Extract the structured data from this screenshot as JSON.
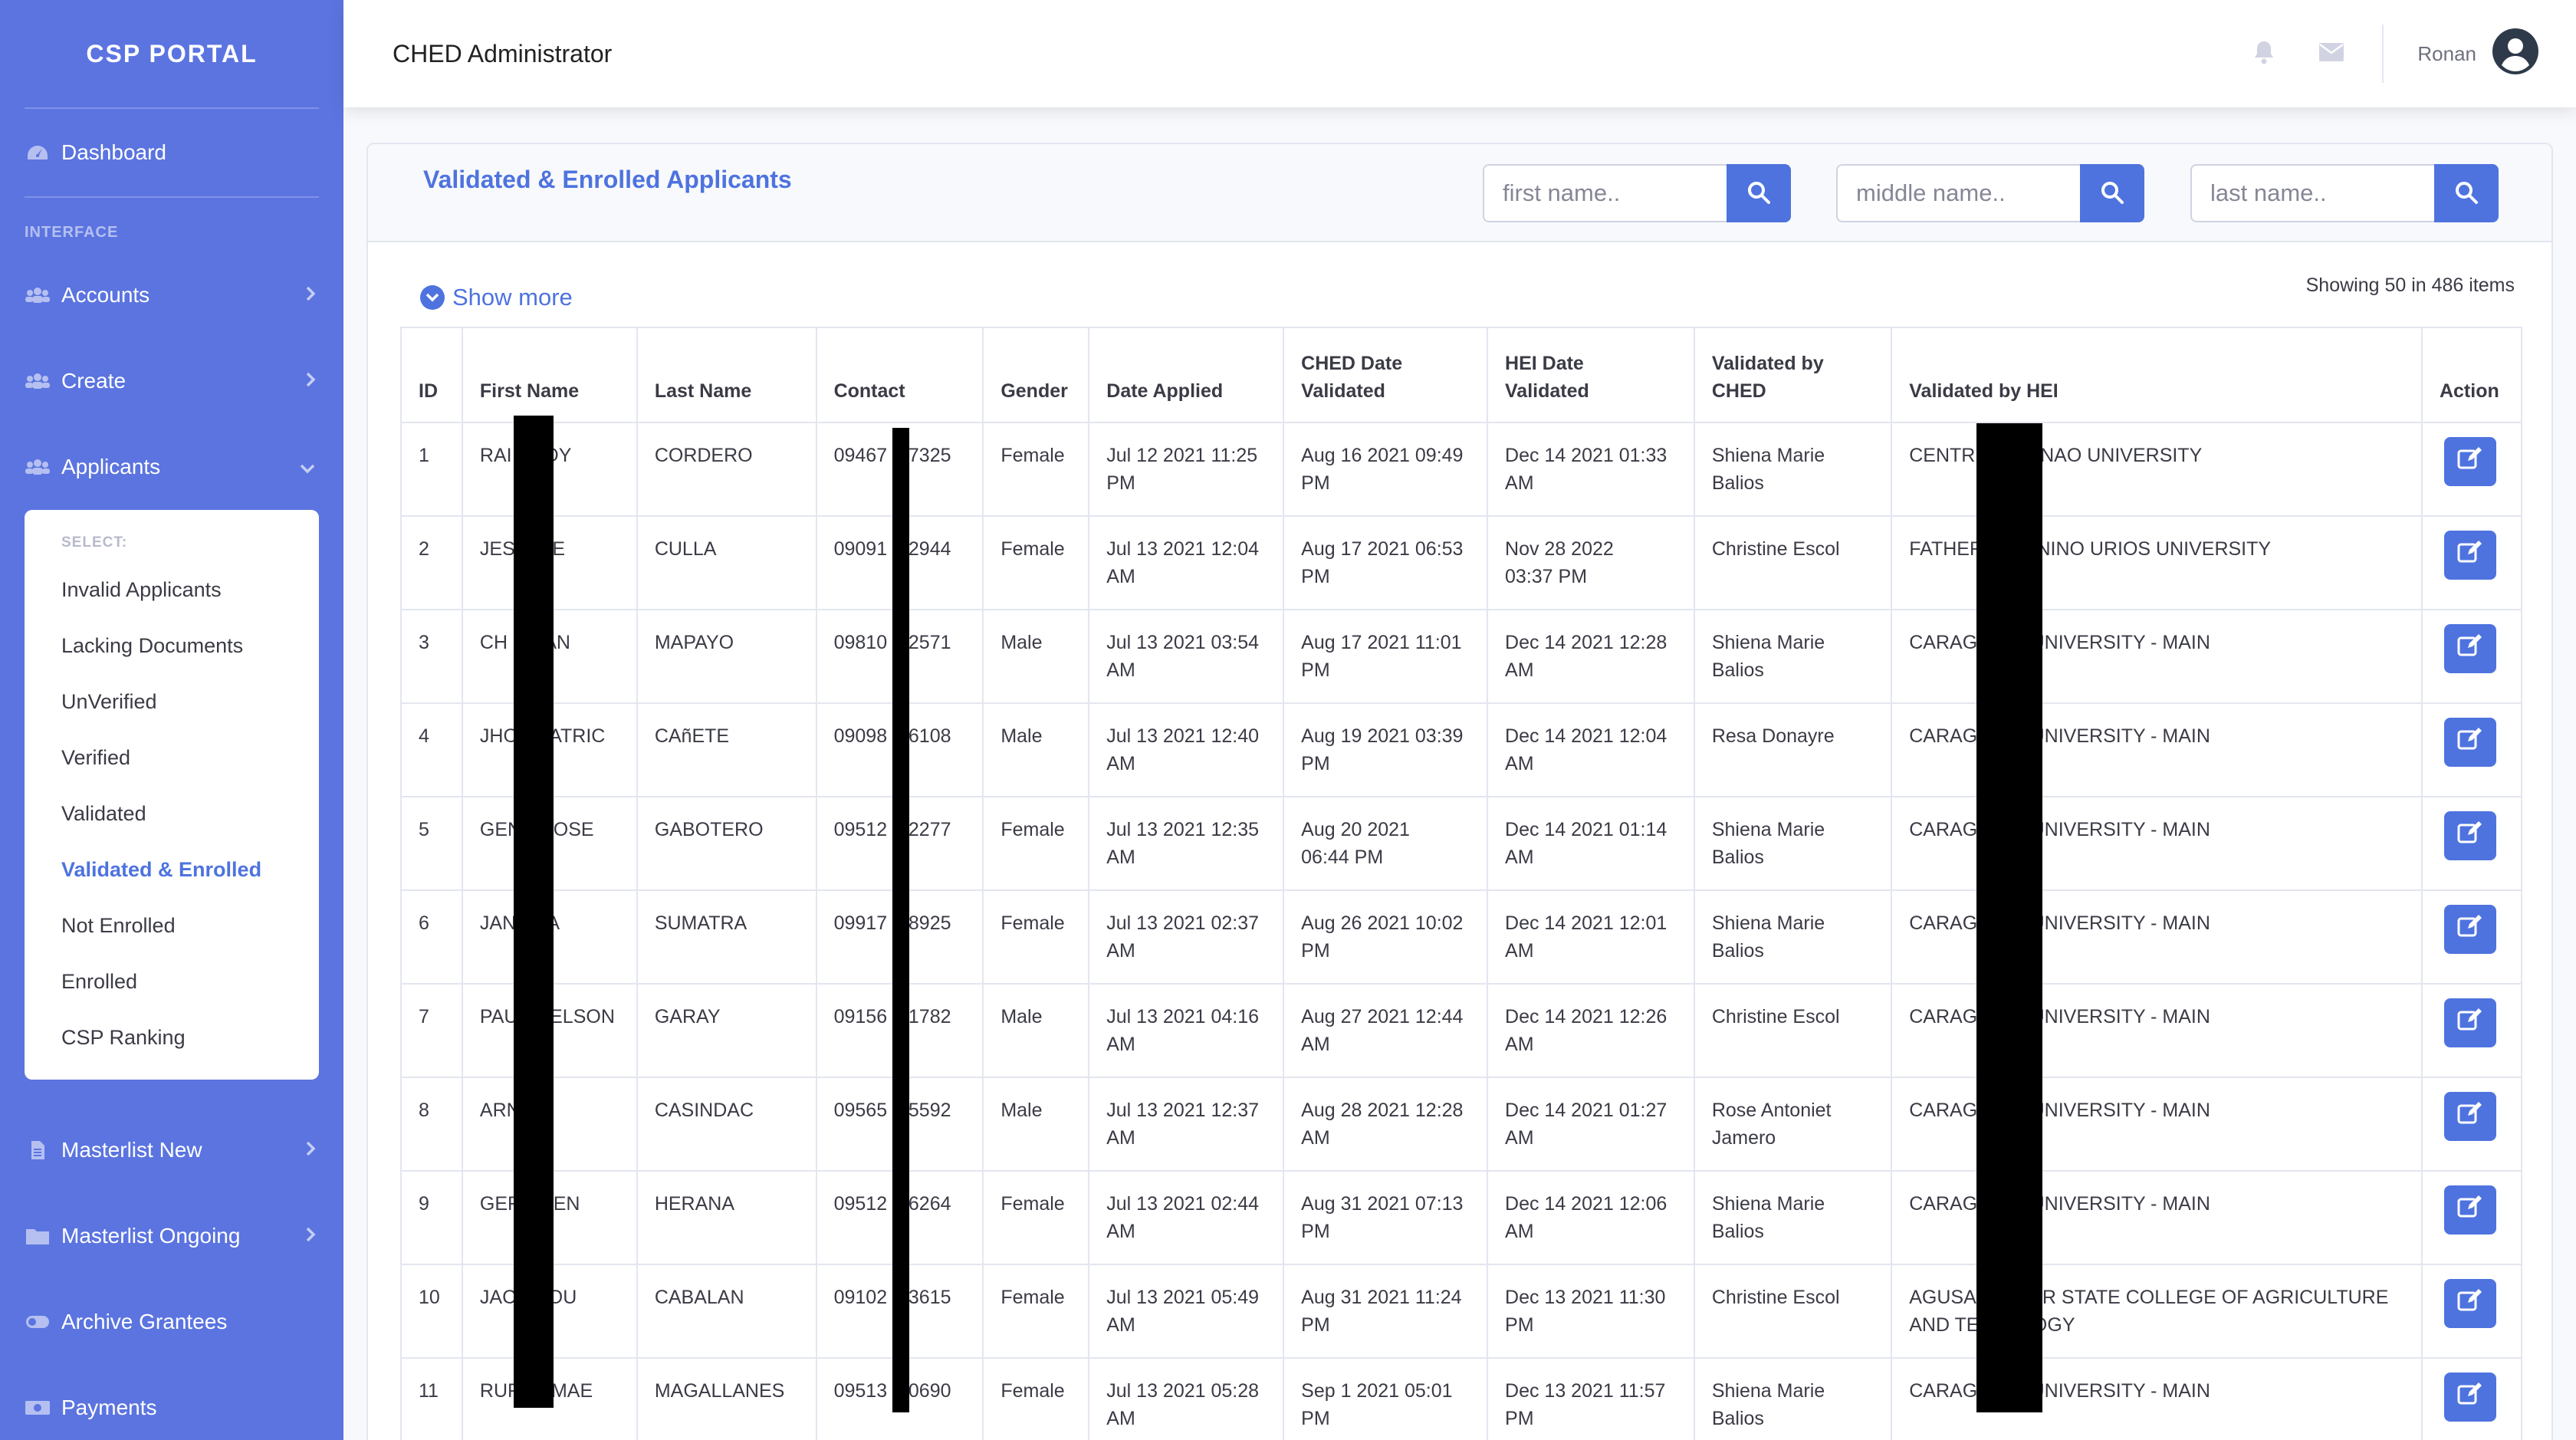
{
  "sidebar": {
    "brand": "CSP PORTAL",
    "dashboard": "Dashboard",
    "interface_heading": "INTERFACE",
    "accounts": "Accounts",
    "create": "Create",
    "applicants": "Applicants",
    "submenu_heading": "SELECT:",
    "submenu": [
      "Invalid Applicants",
      "Lacking Documents",
      "UnVerified",
      "Verified",
      "Validated",
      "Validated & Enrolled",
      "Not Enrolled",
      "Enrolled",
      "CSP Ranking"
    ],
    "submenu_active": "Validated & Enrolled",
    "masterlist_new": "Masterlist New",
    "masterlist_ongoing": "Masterlist Ongoing",
    "archive_grantees": "Archive Grantees",
    "payments": "Payments"
  },
  "topbar": {
    "title": "CHED Administrator",
    "user_name": "Ronan"
  },
  "card": {
    "title": "Validated & Enrolled Applicants",
    "search_first_placeholder": "first name..",
    "search_middle_placeholder": "middle name..",
    "search_last_placeholder": "last name..",
    "show_more": "Show more",
    "showing": "Showing 50 in 486 items"
  },
  "table": {
    "headers": {
      "id": "ID",
      "first_name": "First Name",
      "last_name": "Last Name",
      "contact": "Contact",
      "gender": "Gender",
      "date_applied": "Date Applied",
      "ched_date_1": "CHED Date",
      "ched_date_2": "Validated",
      "hei_date_1": "HEI Date",
      "hei_date_2": "Validated",
      "validated_ched_1": "Validated by",
      "validated_ched_2": "CHED",
      "validated_hei": "Validated by HEI",
      "action": "Action"
    },
    "rows": [
      {
        "id": "1",
        "first": "RAI      OY",
        "last": "CORDERO",
        "contact": "09467  97325",
        "gender": "Female",
        "applied_1": "Jul 12 2021 11:25",
        "applied_2": "PM",
        "ched_1": "Aug 16 2021 09:49",
        "ched_2": "PM",
        "hei_1": "Dec 14 2021 01:33",
        "hei_2": "AM",
        "vched_1": "Shiena Marie",
        "vched_2": "Balios",
        "vhei_1": "CENTR          ANAO UNIVERSITY",
        "vhei_2": ""
      },
      {
        "id": "2",
        "first": "JES      IE",
        "last": "CULLA",
        "contact": "09091  62944",
        "gender": "Female",
        "applied_1": "Jul 13 2021 12:04",
        "applied_2": "AM",
        "ched_1": "Aug 17 2021 06:53",
        "ched_2": "PM",
        "hei_1": "Nov 28 2022",
        "hei_2": "03:37 PM",
        "vched_1": "Christine Escol",
        "vched_2": "",
        "vhei_1": "FATHER          NINO URIOS UNIVERSITY",
        "vhei_2": ""
      },
      {
        "id": "3",
        "first": "CH       AN",
        "last": "MAPAYO",
        "contact": "09810  22571",
        "gender": "Male",
        "applied_1": "Jul 13 2021 03:54",
        "applied_2": "AM",
        "ched_1": "Aug 17 2021 11:01",
        "ched_2": "PM",
        "hei_1": "Dec 14 2021 12:28",
        "hei_2": "AM",
        "vched_1": "Shiena Marie",
        "vched_2": "Balios",
        "vhei_1": "CARAG          UNIVERSITY - MAIN",
        "vhei_2": ""
      },
      {
        "id": "4",
        "first": "JHO      ATRIC",
        "last": "CAñETE",
        "contact": "09098  76108",
        "gender": "Male",
        "applied_1": "Jul 13 2021 12:40",
        "applied_2": "AM",
        "ched_1": "Aug 19 2021 03:39",
        "ched_2": "PM",
        "hei_1": "Dec 14 2021 12:04",
        "hei_2": "AM",
        "vched_1": "Resa Donayre",
        "vched_2": "",
        "vhei_1": "CARAG          UNIVERSITY - MAIN",
        "vhei_2": ""
      },
      {
        "id": "5",
        "first": "GEN      OSE",
        "last": "GABOTERO",
        "contact": "09512  32277",
        "gender": "Female",
        "applied_1": "Jul 13 2021 12:35",
        "applied_2": "AM",
        "ched_1": "Aug 20 2021",
        "ched_2": "06:44 PM",
        "hei_1": "Dec 14 2021 01:14",
        "hei_2": "AM",
        "vched_1": "Shiena Marie",
        "vched_2": "Balios",
        "vhei_1": "CARAG          UNIVERSITY - MAIN",
        "vhei_2": ""
      },
      {
        "id": "6",
        "first": "JAN      A",
        "last": "SUMATRA",
        "contact": "09917  58925",
        "gender": "Female",
        "applied_1": "Jul 13 2021 02:37",
        "applied_2": "AM",
        "ched_1": "Aug 26 2021 10:02",
        "ched_2": "PM",
        "hei_1": "Dec 14 2021 12:01",
        "hei_2": "AM",
        "vched_1": "Shiena Marie",
        "vched_2": "Balios",
        "vhei_1": "CARAG          UNIVERSITY - MAIN",
        "vhei_2": ""
      },
      {
        "id": "7",
        "first": "PAU      ELSON",
        "last": "GARAY",
        "contact": "09156  61782",
        "gender": "Male",
        "applied_1": "Jul 13 2021 04:16",
        "applied_2": "AM",
        "ched_1": "Aug 27 2021 12:44",
        "ched_2": "AM",
        "hei_1": "Dec 14 2021 12:26",
        "hei_2": "AM",
        "vched_1": "Christine Escol",
        "vched_2": "",
        "vhei_1": "CARAG          UNIVERSITY - MAIN",
        "vhei_2": ""
      },
      {
        "id": "8",
        "first": "ARN",
        "last": "CASINDAC",
        "contact": "09565  45592",
        "gender": "Male",
        "applied_1": "Jul 13 2021 12:37",
        "applied_2": "AM",
        "ched_1": "Aug 28 2021 12:28",
        "ched_2": "AM",
        "hei_1": "Dec 14 2021 01:27",
        "hei_2": "AM",
        "vched_1": "Rose Antoniet",
        "vched_2": "Jamero",
        "vhei_1": "CARAG          UNIVERSITY - MAIN",
        "vhei_2": ""
      },
      {
        "id": "9",
        "first": "GER      EN",
        "last": "HERANA",
        "contact": "09512  56264",
        "gender": "Female",
        "applied_1": "Jul 13 2021 02:44",
        "applied_2": "AM",
        "ched_1": "Aug 31 2021 07:13",
        "ched_2": "PM",
        "hei_1": "Dec 14 2021 12:06",
        "hei_2": "AM",
        "vched_1": "Shiena Marie",
        "vched_2": "Balios",
        "vhei_1": "CARAG          UNIVERSITY - MAIN",
        "vhei_2": ""
      },
      {
        "id": "10",
        "first": "JAC      OU",
        "last": "CABALAN",
        "contact": "09102  33615",
        "gender": "Female",
        "applied_1": "Jul 13 2021 05:49",
        "applied_2": "AM",
        "ched_1": "Aug 31 2021 11:24",
        "ched_2": "PM",
        "hei_1": "Dec 13 2021 11:30",
        "hei_2": "PM",
        "vched_1": "Christine Escol",
        "vched_2": "",
        "vhei_1": "AGUSA          UR STATE COLLEGE OF AGRICULTURE",
        "vhei_2": "AND TE          OGY"
      },
      {
        "id": "11",
        "first": "RUF      MAE",
        "last": "MAGALLANES",
        "contact": "09513  70690",
        "gender": "Female",
        "applied_1": "Jul 13 2021 05:28",
        "applied_2": "AM",
        "ched_1": "Sep 1 2021 05:01",
        "ched_2": "PM",
        "hei_1": "Dec 13 2021 11:57",
        "hei_2": "PM",
        "vched_1": "Shiena Marie",
        "vched_2": "Balios",
        "vhei_1": "CARAG          UNIVERSITY - MAIN",
        "vhei_2": ""
      }
    ]
  },
  "colors": {
    "sidebar": "#5b74e0",
    "primary": "#4e73df",
    "redaction": "#000000"
  },
  "icons": [
    "tachometer-icon",
    "users-icon",
    "chevron-right-icon",
    "chevron-down-icon",
    "file-icon",
    "folder-icon",
    "toggle-icon",
    "money-icon",
    "bell-icon",
    "envelope-icon",
    "user-circle-icon",
    "search-icon",
    "chevron-circle-down-icon",
    "edit-icon"
  ]
}
